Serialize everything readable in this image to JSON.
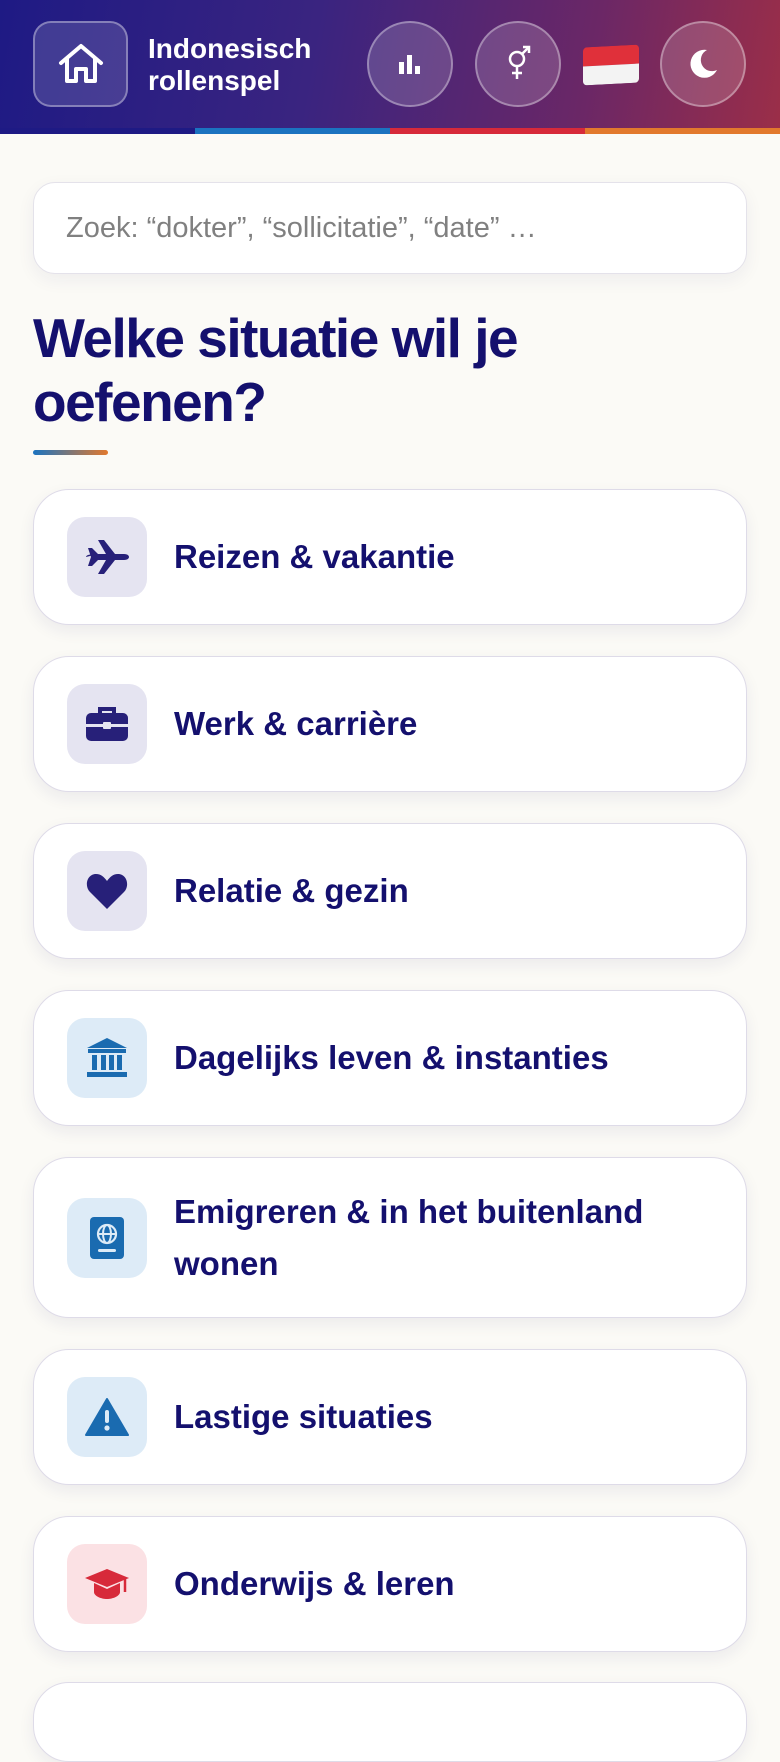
{
  "header": {
    "title": "Indonesisch rollenspel",
    "stripe_colors": [
      "#1e1a84",
      "#1b73c0",
      "#d72a3a",
      "#e2792d"
    ]
  },
  "search": {
    "placeholder": "Zoek: “dokter”, “sollicitatie”, “date” …"
  },
  "main": {
    "heading": "Welke situatie wil je oefenen?",
    "categories": [
      {
        "label": "Reizen & vakantie",
        "icon": "airplane-icon",
        "tone": "navy"
      },
      {
        "label": "Werk & carrière",
        "icon": "briefcase-icon",
        "tone": "navy"
      },
      {
        "label": "Relatie & gezin",
        "icon": "heart-icon",
        "tone": "navy"
      },
      {
        "label": "Dagelijks leven & instanties",
        "icon": "bank-icon",
        "tone": "blue"
      },
      {
        "label": "Emigreren & in het buitenland wonen",
        "icon": "passport-icon",
        "tone": "blue"
      },
      {
        "label": "Lastige situaties",
        "icon": "warning-icon",
        "tone": "blue"
      },
      {
        "label": "Onderwijs & leren",
        "icon": "graduation-cap-icon",
        "tone": "red"
      }
    ]
  },
  "colors": {
    "heading_text": "#14106e",
    "navy_icon": "#272079",
    "blue_icon": "#1a6bb0",
    "red_icon": "#d72a3a"
  }
}
